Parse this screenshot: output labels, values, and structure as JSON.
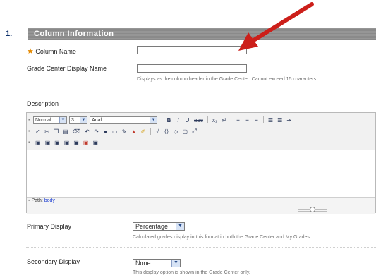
{
  "section": {
    "number": "1.",
    "title": "Column Information"
  },
  "column_name": {
    "label": "Column Name",
    "required_mark": "★",
    "value": ""
  },
  "display_name": {
    "label": "Grade Center Display Name",
    "value": "",
    "hint": "Displays as the column header in the Grade Center. Cannot exceed 15 characters."
  },
  "description": {
    "label": "Description",
    "toolbar": {
      "format": "Normal",
      "size": "3",
      "font": "Arial",
      "bold": "B",
      "italic": "I",
      "underline": "U",
      "strike": "abc",
      "subscript": "x₁",
      "superscript": "x²"
    },
    "path_label": "Path:",
    "path_value": "body"
  },
  "primary_display": {
    "label": "Primary Display",
    "value": "Percentage",
    "hint": "Calculated grades display in this format in both the Grade Center and My Grades."
  },
  "secondary_display": {
    "label": "Secondary Display",
    "value": "None",
    "hint": "This display option is shown in the Grade Center only."
  },
  "colors": {
    "accent_arrow": "#cc1f1a",
    "header_bg": "#8a8a8a",
    "link": "#1d3fd1"
  }
}
